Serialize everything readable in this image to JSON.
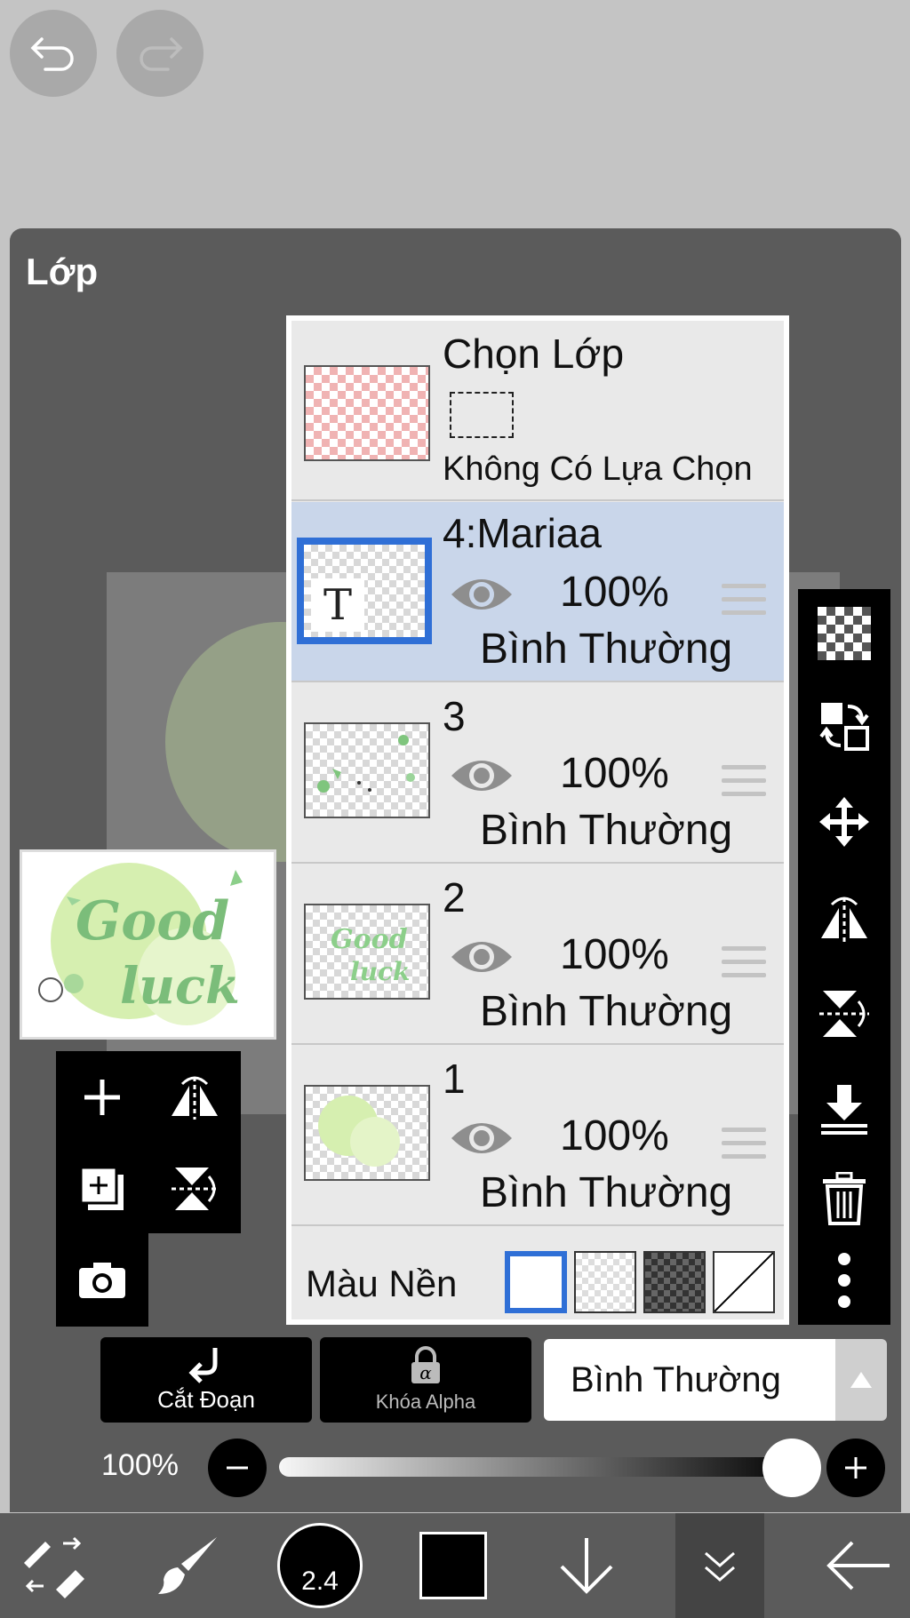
{
  "panel": {
    "title": "Lớp"
  },
  "selection_row": {
    "title": "Chọn Lớp",
    "subtitle": "Không Có Lựa Chọn"
  },
  "layers": [
    {
      "name": "4:Mariaa",
      "opacity": "100%",
      "blend": "Bình Thường",
      "selected": true,
      "thumb_letter": "T"
    },
    {
      "name": "3",
      "opacity": "100%",
      "blend": "Bình Thường",
      "selected": false
    },
    {
      "name": "2",
      "opacity": "100%",
      "blend": "Bình Thường",
      "selected": false,
      "thumb_text_1": "Good",
      "thumb_text_2": "luck"
    },
    {
      "name": "1",
      "opacity": "100%",
      "blend": "Bình Thường",
      "selected": false
    }
  ],
  "background": {
    "label": "Màu Nền"
  },
  "actions": {
    "clip_label": "Cắt Đoạn",
    "alpha_lock_label": "Khóa Alpha",
    "blend_mode": "Bình Thường"
  },
  "opacity_slider": {
    "label": "100%",
    "value": 1.0
  },
  "brush": {
    "size": "2.4"
  },
  "colors": {
    "accent": "#2f6fd6",
    "selected_row": "#c9d6ea",
    "primary": "#000000"
  },
  "preview": {
    "text_1": "Good",
    "text_2": "luck"
  }
}
